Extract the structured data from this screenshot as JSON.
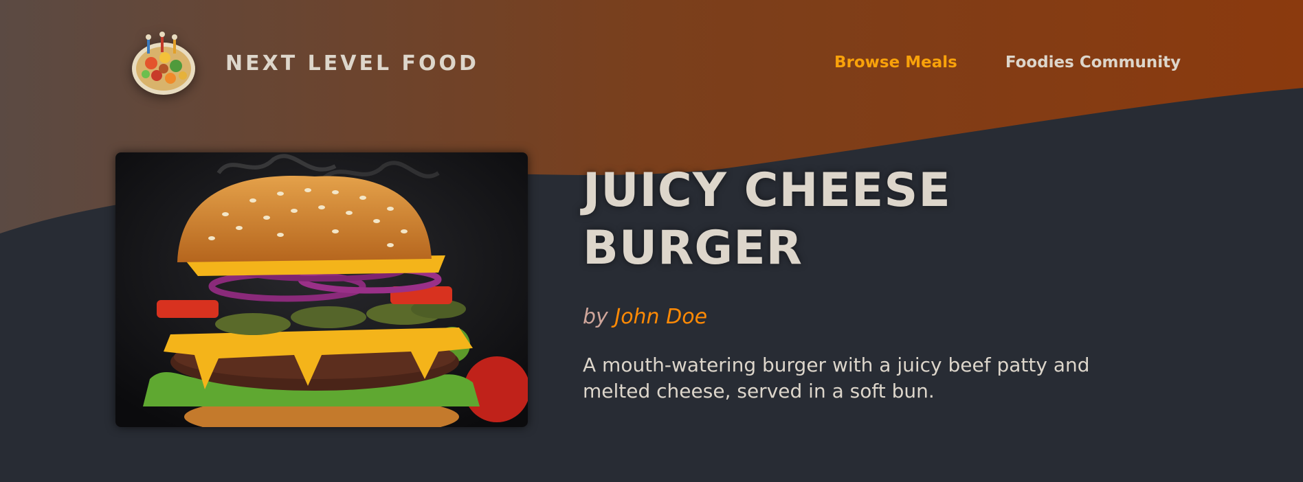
{
  "header": {
    "brand": "NEXT LEVEL FOOD",
    "logo_icon": "food-platter-icon",
    "nav": [
      {
        "label": "Browse Meals",
        "active": true
      },
      {
        "label": "Foodies Community",
        "active": false
      }
    ]
  },
  "meal": {
    "title": "JUICY CHEESE BURGER",
    "by_prefix": "by",
    "creator": "John Doe",
    "summary": "A mouth-watering burger with a juicy beef patty and melted cheese, served in a soft bun.",
    "image_icon": "cheeseburger-image"
  },
  "colors": {
    "background": "#282c34",
    "header_gradient_start": "#5a4a42",
    "header_gradient_end": "#8c3a0f",
    "accent": "#f9a20a",
    "creator_accent": "#ff8a05",
    "text": "#ddd6cb"
  }
}
